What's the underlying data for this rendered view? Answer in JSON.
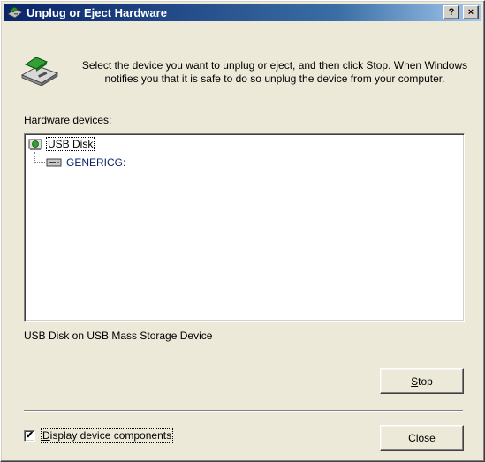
{
  "window": {
    "title": "Unplug or Eject Hardware",
    "help_button": "?",
    "close_button": "×"
  },
  "intro": {
    "text": "Select the device you want to unplug or eject, and then click Stop. When Windows notifies you that it is safe to do so unplug the device from your computer."
  },
  "hardware": {
    "label_accel": "H",
    "label_rest": "ardware devices:",
    "tree": [
      {
        "label": "USB Disk",
        "icon": "usb-disk-icon",
        "selected": true
      },
      {
        "label": "GENERICG:",
        "icon": "drive-icon",
        "selected": false
      }
    ]
  },
  "status": {
    "text": "USB Disk on USB Mass Storage Device"
  },
  "buttons": {
    "stop_accel": "S",
    "stop_rest": "top",
    "close_accel": "C",
    "close_rest": "lose"
  },
  "options": {
    "display_components_accel": "D",
    "display_components_rest": "isplay device components",
    "display_components_checked": true,
    "check_mark": "✔"
  },
  "colors": {
    "titlebar_start": "#0a246a",
    "titlebar_end": "#a6caf0",
    "dialog_bg": "#ece9d8"
  }
}
